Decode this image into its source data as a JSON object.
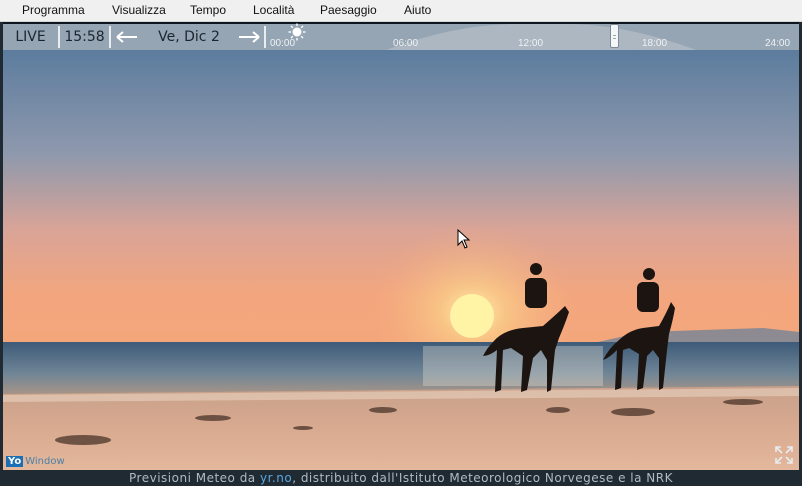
{
  "menu": {
    "items": [
      {
        "label": "Programma"
      },
      {
        "label": "Visualizza"
      },
      {
        "label": "Tempo"
      },
      {
        "label": "Località"
      },
      {
        "label": "Paesaggio"
      },
      {
        "label": "Aiuto"
      }
    ]
  },
  "toolbar": {
    "live_label": "LIVE",
    "time": "15:58",
    "date": "Ve, Dic 2",
    "prev_icon": "arrow-left-icon",
    "next_icon": "arrow-right-icon"
  },
  "timeline": {
    "weather_icon": "sun-icon",
    "ticks": [
      "00:00",
      "06:00",
      "12:00",
      "18:00",
      "24:00"
    ],
    "current_fraction": 0.665
  },
  "brand": {
    "prefix": "Yo",
    "suffix": "Window"
  },
  "footer": {
    "prefix": "Previsioni Meteo da ",
    "link": "yr.no",
    "suffix": ", distribuito dall'Istituto Meteorologico Norvegese e la NRK"
  },
  "colors": {
    "toolbar": "#96a5b3",
    "link": "#59a7e0",
    "menubar": "#f0f0f0"
  }
}
